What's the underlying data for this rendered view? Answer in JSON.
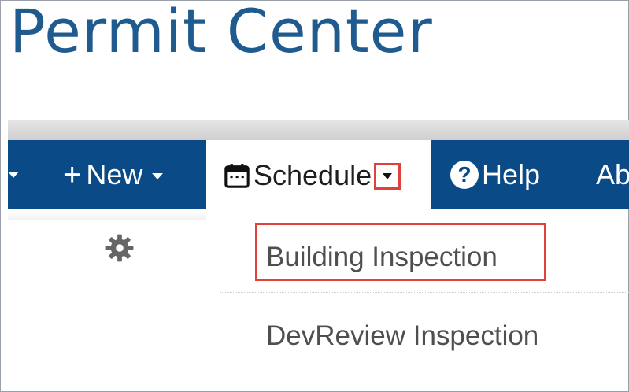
{
  "header": {
    "title": "Permit Center"
  },
  "nav": {
    "new_label": "New",
    "schedule_label": "Schedule",
    "help_label": "Help",
    "about_label": "Ab"
  },
  "dropdown": {
    "items": [
      {
        "label": "Building Inspection",
        "highlighted": true
      },
      {
        "label": "DevReview Inspection",
        "highlighted": false
      }
    ]
  },
  "icons": [
    "caret-down-icon",
    "plus-icon",
    "calendar-icon",
    "question-circle-icon",
    "gear-icon"
  ],
  "colors": {
    "brand_blue": "#0a4a86",
    "title_blue": "#1f5b8f",
    "highlight_red": "#e0413b",
    "menu_text": "#4f4f4f"
  }
}
